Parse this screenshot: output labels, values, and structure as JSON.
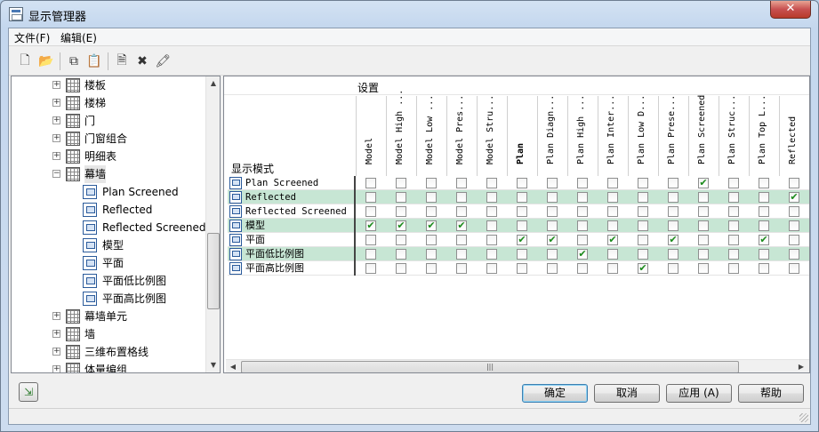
{
  "window": {
    "title": "显示管理器",
    "close_glyph": "✕"
  },
  "menu": [
    {
      "label": "文件(F)"
    },
    {
      "label": "编辑(E)"
    }
  ],
  "toolbar": [
    {
      "icon": "new-icon",
      "glyph": "🗋"
    },
    {
      "icon": "open-icon",
      "glyph": "📂"
    },
    {
      "icon": "copy-icon",
      "glyph": "⧉"
    },
    {
      "icon": "paste-icon",
      "glyph": "📋"
    },
    {
      "icon": "new-item-icon",
      "glyph": "🗎"
    },
    {
      "icon": "delete-icon",
      "glyph": "✖"
    },
    {
      "icon": "rename-icon",
      "glyph": "🖍"
    }
  ],
  "tree": [
    {
      "label": "楼板",
      "level": 0,
      "expander": "+",
      "icon": "slab-icon"
    },
    {
      "label": "楼梯",
      "level": 0,
      "expander": "+",
      "icon": "stair-icon"
    },
    {
      "label": "门",
      "level": 0,
      "expander": "+",
      "icon": "door-icon"
    },
    {
      "label": "门窗组合",
      "level": 0,
      "expander": "+",
      "icon": "door-window-assembly-icon"
    },
    {
      "label": "明细表",
      "level": 0,
      "expander": "+",
      "icon": "schedule-icon"
    },
    {
      "label": "幕墙",
      "level": 0,
      "expander": "−",
      "icon": "curtain-wall-icon",
      "selected": true
    },
    {
      "label": "Plan Screened",
      "level": 1,
      "icon": "display-rep-icon"
    },
    {
      "label": "Reflected",
      "level": 1,
      "icon": "display-rep-icon"
    },
    {
      "label": "Reflected Screened",
      "level": 1,
      "icon": "display-rep-icon"
    },
    {
      "label": "模型",
      "level": 1,
      "icon": "display-rep-icon"
    },
    {
      "label": "平面",
      "level": 1,
      "icon": "display-rep-icon"
    },
    {
      "label": "平面低比例图",
      "level": 1,
      "icon": "display-rep-icon"
    },
    {
      "label": "平面高比例图",
      "level": 1,
      "icon": "display-rep-icon"
    },
    {
      "label": "幕墙单元",
      "level": 0,
      "expander": "+",
      "icon": "curtain-wall-unit-icon"
    },
    {
      "label": "墙",
      "level": 0,
      "expander": "+",
      "icon": "wall-icon"
    },
    {
      "label": "三维布置格线",
      "level": 0,
      "expander": "+",
      "icon": "layout-grid-3d-icon"
    },
    {
      "label": "体量编组",
      "level": 0,
      "expander": "+",
      "icon": "mass-group-icon"
    }
  ],
  "grid": {
    "settings_label": "设置",
    "mode_label": "显示模式",
    "columns": [
      "Model",
      "Model High ...",
      "Model Low ...",
      "Model Pres...",
      "Model Stru...",
      "Plan",
      "Plan Diagn...",
      "Plan High ...",
      "Plan Inter...",
      "Plan Low D...",
      "Plan Prese...",
      "Plan Screened",
      "Plan Struc...",
      "Plan Top L...",
      "Reflected"
    ],
    "rows": [
      {
        "label": "Plan Screened",
        "checked": [
          11
        ],
        "highlight": false
      },
      {
        "label": "Reflected",
        "checked": [
          14
        ],
        "highlight": true
      },
      {
        "label": "Reflected Screened",
        "checked": [],
        "highlight": false
      },
      {
        "label": "模型",
        "checked": [
          0,
          1,
          2,
          3
        ],
        "highlight": true
      },
      {
        "label": "平面",
        "checked": [
          5,
          6,
          8,
          10,
          13
        ],
        "highlight": false
      },
      {
        "label": "平面低比例图",
        "checked": [
          7
        ],
        "highlight": true
      },
      {
        "label": "平面高比例图",
        "checked": [
          9
        ],
        "highlight": false
      }
    ],
    "check_glyph": "✔"
  },
  "scroll": {
    "up": "▲",
    "down": "▼",
    "left": "◀",
    "right": "▶",
    "grip": "|||"
  },
  "buttons": {
    "ok": "确定",
    "cancel": "取消",
    "apply": "应用 (A)",
    "help": "帮助"
  },
  "bottom_icon_glyph": "⇲"
}
